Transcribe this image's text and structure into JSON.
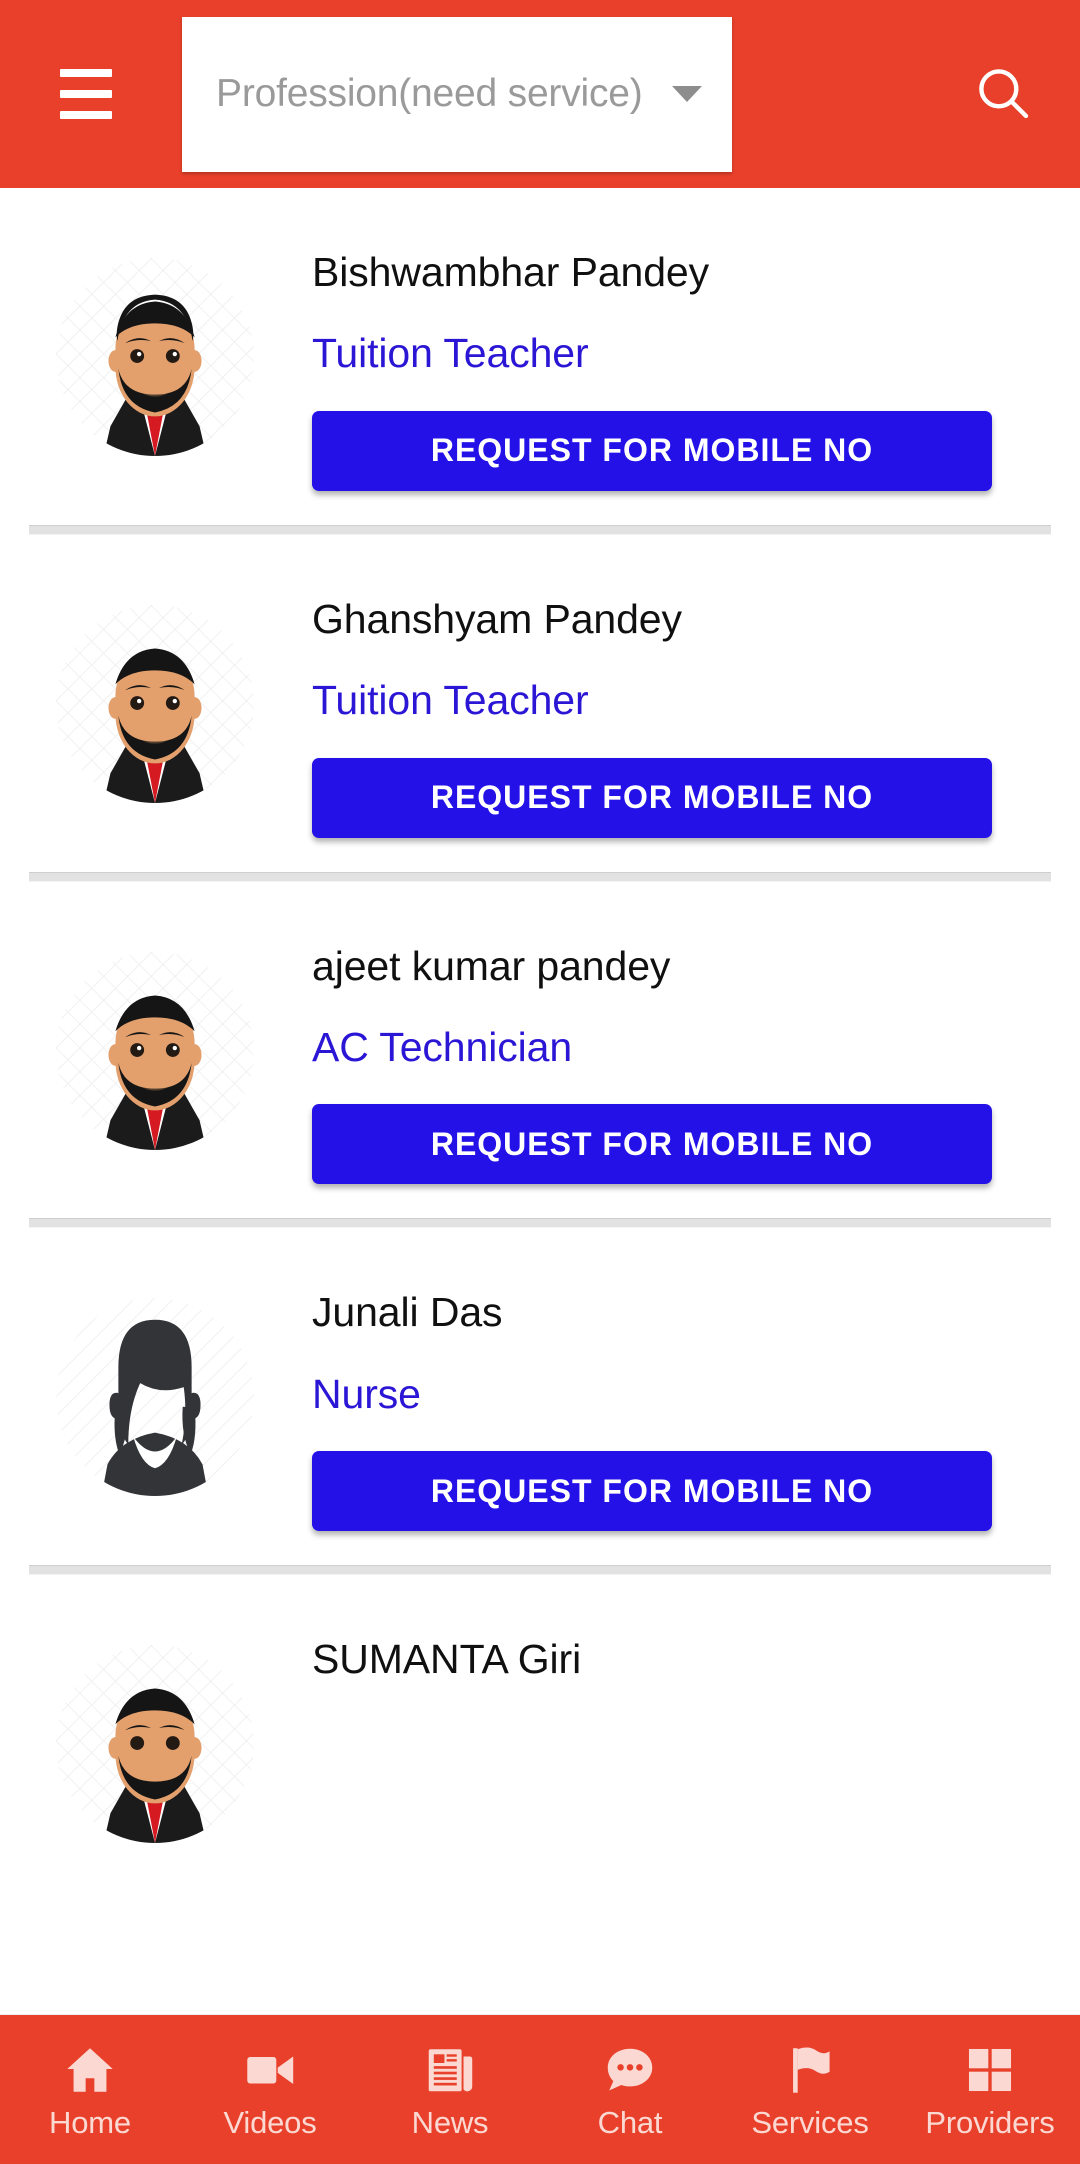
{
  "header": {
    "menu_icon": "hamburger-menu-icon",
    "search_icon": "search-icon",
    "dropdown_icon": "chevron-down-icon",
    "search_placeholder": "Profession(need service)",
    "search_value": "",
    "bar_color": "#E8402A"
  },
  "theme": {
    "primary_red": "#E8402A",
    "button_blue": "#2311E8",
    "profession_blue": "#2B16D6",
    "nav_icon_tint": "#FBD9D2",
    "name_text": "#101010",
    "divider": "#e2e2e2"
  },
  "providers": [
    {
      "name": "Bishwambhar Pandey",
      "profession": "Tuition Teacher",
      "avatar": "male-avatar-beard-suit",
      "button_label": "REQUEST FOR MOBILE NO"
    },
    {
      "name": "Ghanshyam Pandey",
      "profession": "Tuition Teacher",
      "avatar": "male-avatar-beard-suit",
      "button_label": "REQUEST FOR MOBILE NO"
    },
    {
      "name": "ajeet kumar pandey",
      "profession": "AC Technician",
      "avatar": "male-avatar-beard-suit",
      "button_label": "REQUEST FOR MOBILE NO"
    },
    {
      "name": "Junali Das",
      "profession": "Nurse",
      "avatar": "female-avatar-silhouette",
      "button_label": "REQUEST FOR MOBILE NO"
    },
    {
      "name": "SUMANTA Giri",
      "profession": "",
      "avatar": "male-avatar-beard-suit",
      "button_label": ""
    }
  ],
  "bottom_nav": {
    "items": [
      {
        "label": "Home",
        "icon": "home-icon"
      },
      {
        "label": "Videos",
        "icon": "video-camera-icon"
      },
      {
        "label": "News",
        "icon": "newspaper-icon"
      },
      {
        "label": "Chat",
        "icon": "chat-bubble-icon"
      },
      {
        "label": "Services",
        "icon": "flag-icon"
      },
      {
        "label": "Providers",
        "icon": "grid-squares-icon"
      }
    ]
  }
}
